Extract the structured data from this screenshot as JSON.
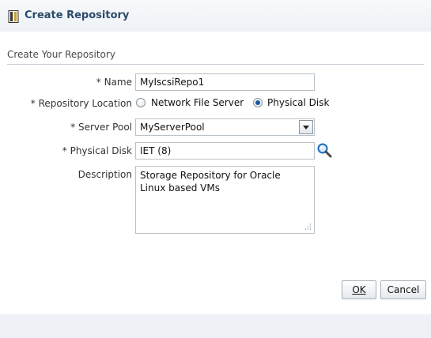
{
  "dialog": {
    "title": "Create Repository",
    "section_title": "Create Your Repository"
  },
  "form": {
    "name": {
      "required_mark": "*",
      "label": "Name",
      "value": "MyIscsiRepo1"
    },
    "repository_location": {
      "required_mark": "*",
      "label": "Repository Location",
      "options": [
        {
          "label": "Network File Server",
          "selected": false
        },
        {
          "label": "Physical Disk",
          "selected": true
        }
      ]
    },
    "server_pool": {
      "required_mark": "*",
      "label": "Server Pool",
      "value": "MyServerPool"
    },
    "physical_disk": {
      "required_mark": "*",
      "label": "Physical Disk",
      "value": "IET (8)"
    },
    "description": {
      "label": "Description",
      "value": "Storage Repository for Oracle\nLinux based VMs"
    }
  },
  "buttons": {
    "ok_label": "OK",
    "cancel_label": "Cancel"
  },
  "icons": {
    "title_icon": "repository-icon",
    "search_icon": "search-icon",
    "dropdown_icon": "chevron-down-icon"
  },
  "colors": {
    "title": "#2c4a6b",
    "radio_selected": "#1b57a8"
  }
}
